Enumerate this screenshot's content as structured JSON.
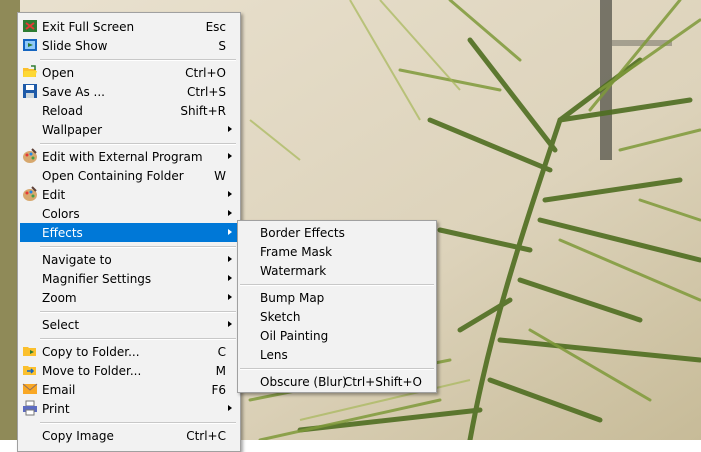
{
  "main_menu": {
    "items": [
      {
        "label": "Exit Full Screen",
        "shortcut": "Esc",
        "icon": "exit-fullscreen-icon"
      },
      {
        "label": "Slide Show",
        "shortcut": "S",
        "icon": "slideshow-icon"
      },
      {
        "label": "Open",
        "shortcut": "Ctrl+O",
        "icon": "open-folder-icon"
      },
      {
        "label": "Save As ...",
        "shortcut": "Ctrl+S",
        "icon": "floppy-disk-icon"
      },
      {
        "label": "Reload",
        "shortcut": "Shift+R"
      },
      {
        "label": "Wallpaper",
        "shortcut": ""
      },
      {
        "label": "Edit with External Program",
        "shortcut": "",
        "icon": "palette-icon"
      },
      {
        "label": "Open Containing Folder",
        "shortcut": "W"
      },
      {
        "label": "Edit",
        "shortcut": "",
        "icon": "palette-icon"
      },
      {
        "label": "Colors",
        "shortcut": ""
      },
      {
        "label": "Effects",
        "shortcut": ""
      },
      {
        "label": "Navigate to",
        "shortcut": ""
      },
      {
        "label": "Magnifier Settings",
        "shortcut": ""
      },
      {
        "label": "Zoom",
        "shortcut": ""
      },
      {
        "label": "Select",
        "shortcut": ""
      },
      {
        "label": "Copy to Folder...",
        "shortcut": "C",
        "icon": "copy-folder-icon"
      },
      {
        "label": "Move to Folder...",
        "shortcut": "M",
        "icon": "move-folder-icon"
      },
      {
        "label": "Email",
        "shortcut": "F6",
        "icon": "email-icon"
      },
      {
        "label": "Print",
        "shortcut": "",
        "icon": "printer-icon"
      },
      {
        "label": "Copy Image",
        "shortcut": "Ctrl+C"
      }
    ]
  },
  "effects_submenu": {
    "items": [
      {
        "label": "Border Effects",
        "shortcut": ""
      },
      {
        "label": "Frame Mask",
        "shortcut": ""
      },
      {
        "label": "Watermark",
        "shortcut": ""
      },
      {
        "label": "Bump Map",
        "shortcut": ""
      },
      {
        "label": "Sketch",
        "shortcut": ""
      },
      {
        "label": "Oil Painting",
        "shortcut": ""
      },
      {
        "label": "Lens",
        "shortcut": ""
      },
      {
        "label": "Obscure (Blur)",
        "shortcut": "Ctrl+Shift+O"
      }
    ]
  },
  "colors": {
    "highlight": "#0078d7",
    "menu_bg": "#f2f2f2"
  }
}
